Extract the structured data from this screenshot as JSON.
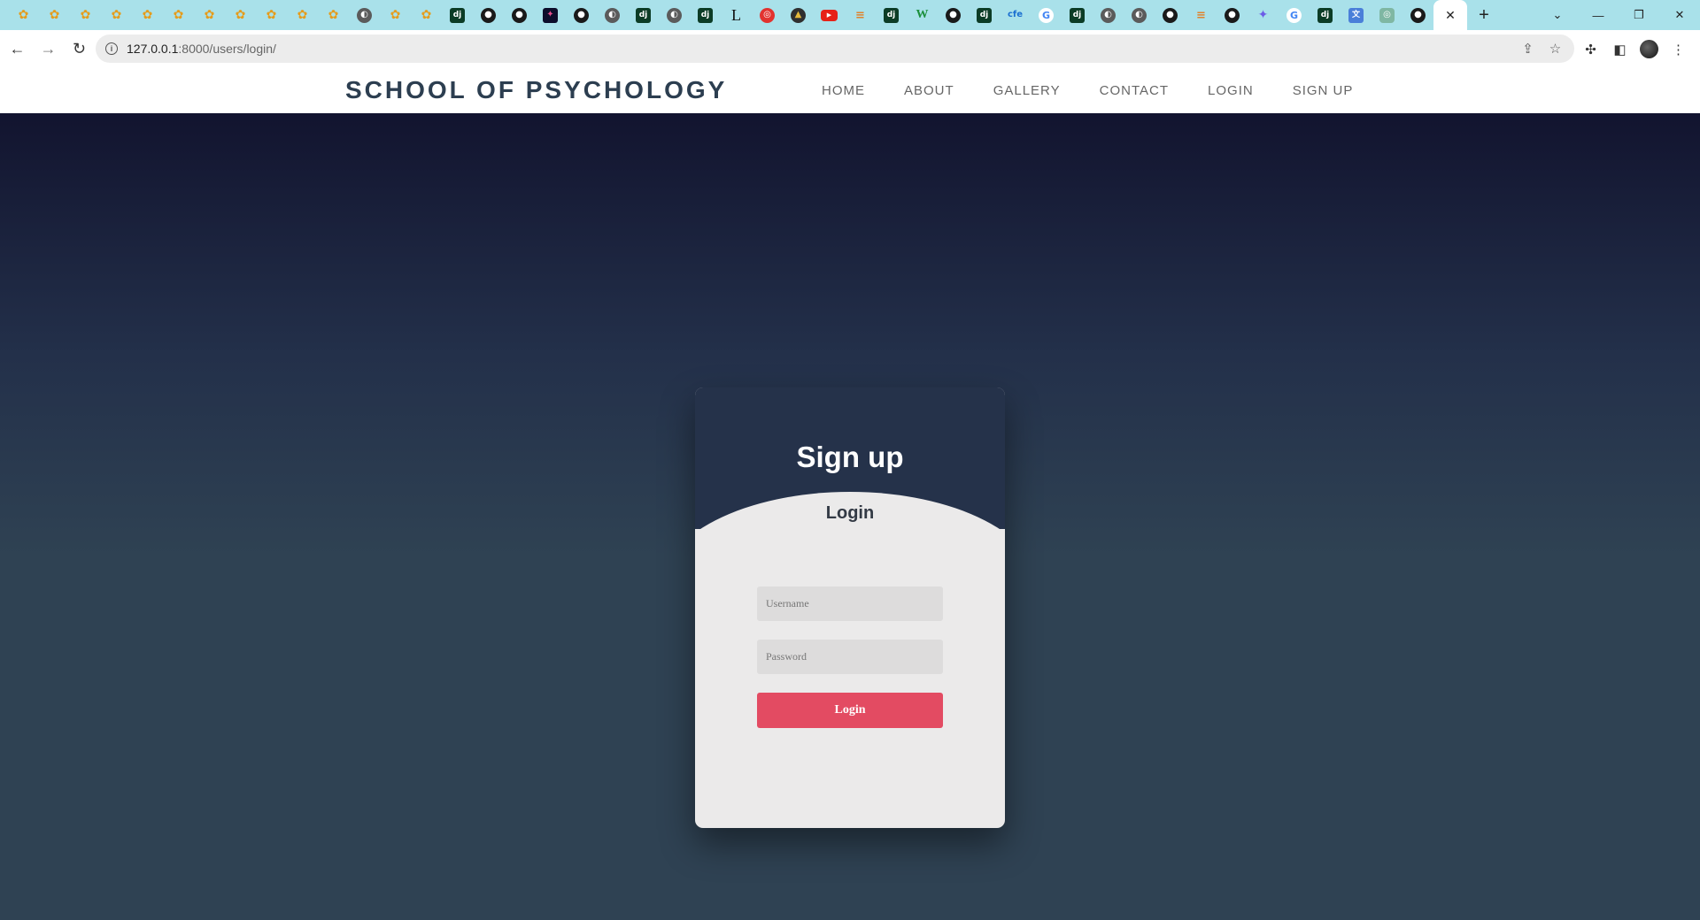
{
  "browser": {
    "tabs": [
      {
        "icon": "owl-icon",
        "glyph": "✿"
      },
      {
        "icon": "owl-icon",
        "glyph": "✿"
      },
      {
        "icon": "owl-icon",
        "glyph": "✿"
      },
      {
        "icon": "owl-icon",
        "glyph": "✿"
      },
      {
        "icon": "owl-icon",
        "glyph": "✿"
      },
      {
        "icon": "owl-icon",
        "glyph": "✿"
      },
      {
        "icon": "owl-icon",
        "glyph": "✿"
      },
      {
        "icon": "owl-icon",
        "glyph": "✿"
      },
      {
        "icon": "owl-icon",
        "glyph": "✿"
      },
      {
        "icon": "owl-icon",
        "glyph": "✿"
      },
      {
        "icon": "owl-icon",
        "glyph": "✿"
      },
      {
        "icon": "globe-icon",
        "glyph": "◐"
      },
      {
        "icon": "owl-icon",
        "glyph": "✿"
      },
      {
        "icon": "owl-icon",
        "glyph": "✿"
      },
      {
        "icon": "django-icon",
        "glyph": "dj"
      },
      {
        "icon": "github-icon",
        "glyph": "●"
      },
      {
        "icon": "github-icon",
        "glyph": "●"
      },
      {
        "icon": "figma-icon",
        "glyph": "✦"
      },
      {
        "icon": "github-icon",
        "glyph": "●"
      },
      {
        "icon": "globe-icon",
        "glyph": "◐"
      },
      {
        "icon": "django-icon",
        "glyph": "dj"
      },
      {
        "icon": "globe-icon",
        "glyph": "◐"
      },
      {
        "icon": "django-icon",
        "glyph": "dj"
      },
      {
        "icon": "letter-l-icon",
        "glyph": "L"
      },
      {
        "icon": "red-circle-icon",
        "glyph": "◎"
      },
      {
        "icon": "graduation-hat-icon",
        "glyph": "▲"
      },
      {
        "icon": "youtube-icon",
        "glyph": "▶"
      },
      {
        "icon": "stackoverflow-icon",
        "glyph": "≡"
      },
      {
        "icon": "django-icon",
        "glyph": "dj"
      },
      {
        "icon": "w-icon",
        "glyph": "W"
      },
      {
        "icon": "github-icon",
        "glyph": "●"
      },
      {
        "icon": "django-icon",
        "glyph": "dj"
      },
      {
        "icon": "cfe-icon",
        "glyph": "cfe"
      },
      {
        "icon": "google-icon",
        "glyph": "G"
      },
      {
        "icon": "django-icon",
        "glyph": "dj"
      },
      {
        "icon": "globe-icon",
        "glyph": "◐"
      },
      {
        "icon": "globe-icon",
        "glyph": "◐"
      },
      {
        "icon": "github-icon",
        "glyph": "●"
      },
      {
        "icon": "stackoverflow-icon",
        "glyph": "≡"
      },
      {
        "icon": "github-icon",
        "glyph": "●"
      },
      {
        "icon": "gemini-icon",
        "glyph": "✦"
      },
      {
        "icon": "google-icon",
        "glyph": "G"
      },
      {
        "icon": "django-icon",
        "glyph": "dj"
      },
      {
        "icon": "translate-icon",
        "glyph": "文"
      },
      {
        "icon": "chatgpt-icon",
        "glyph": "◎"
      },
      {
        "icon": "github-icon",
        "glyph": "●"
      }
    ],
    "active_tab_close": "✕",
    "new_tab": "+",
    "window_controls": {
      "dropdown": "⌄",
      "minimize": "—",
      "restore": "❐",
      "close": "✕"
    },
    "url_host": "127.0.0.1",
    "url_path": ":8000/users/login/"
  },
  "site": {
    "brand": "SCHOOL OF PSYCHOLOGY",
    "nav": [
      "HOME",
      "ABOUT",
      "GALLERY",
      "CONTACT",
      "LOGIN",
      "SIGN UP"
    ]
  },
  "card": {
    "title": "Sign up",
    "subtitle": "Login",
    "username_placeholder": "Username",
    "password_placeholder": "Password",
    "login_button": "Login"
  },
  "colors": {
    "tabbar": "#a9e1ea",
    "brand": "#2c3e50",
    "card_header": "#25324a",
    "login_button": "#e34b62",
    "hero_top": "#12142f",
    "hero_bottom": "#2f4253"
  }
}
